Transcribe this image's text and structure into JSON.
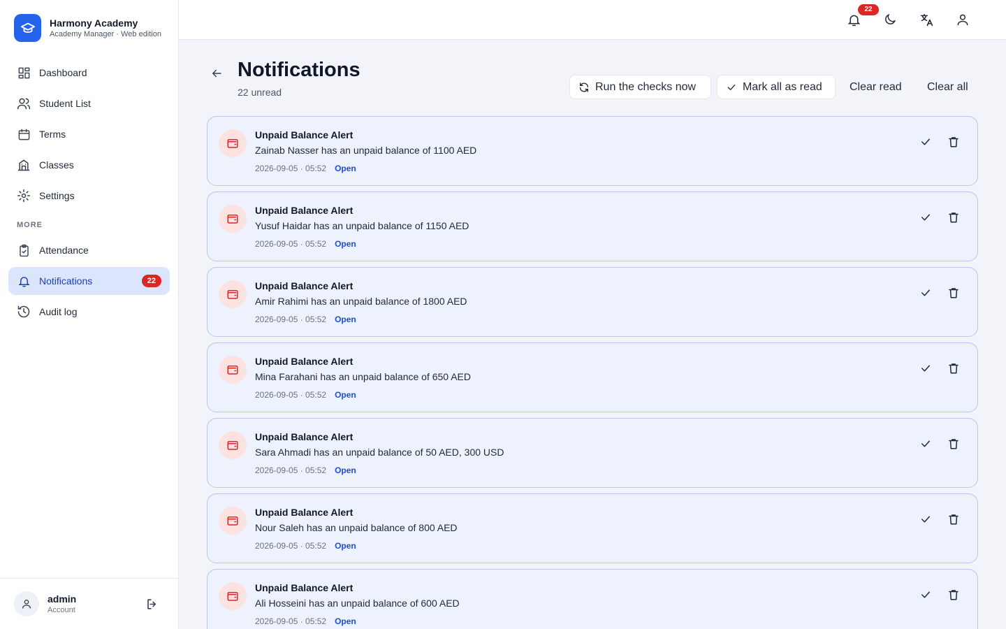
{
  "brand": {
    "name": "Harmony Academy",
    "subtitle": "Academy Manager · Web edition"
  },
  "sidebar": {
    "items": [
      {
        "label": "Dashboard",
        "icon": "dashboard-icon"
      },
      {
        "label": "Student List",
        "icon": "users-icon"
      },
      {
        "label": "Terms",
        "icon": "calendar-icon"
      },
      {
        "label": "Classes",
        "icon": "building-icon"
      },
      {
        "label": "Settings",
        "icon": "gear-icon"
      }
    ],
    "section_label": "MORE",
    "more_items": [
      {
        "label": "Attendance",
        "icon": "clipboard-icon"
      },
      {
        "label": "Notifications",
        "icon": "bell-icon",
        "badge": "22",
        "active": true
      },
      {
        "label": "Audit log",
        "icon": "history-icon"
      }
    ],
    "account": {
      "name": "admin",
      "role": "Account"
    }
  },
  "topbar": {
    "notification_count": "22"
  },
  "header": {
    "title": "Notifications",
    "unread": "22 unread",
    "actions": {
      "run_checks": "Run the checks now",
      "mark_all_read": "Mark all as read",
      "clear_read": "Clear read",
      "clear_all": "Clear all"
    }
  },
  "notifications": [
    {
      "title": "Unpaid Balance Alert",
      "message": "Zainab Nasser has an unpaid balance of 1100 AED",
      "time": "2026-09-05 · 05:52",
      "link": "Open"
    },
    {
      "title": "Unpaid Balance Alert",
      "message": "Yusuf Haidar has an unpaid balance of 1150 AED",
      "time": "2026-09-05 · 05:52",
      "link": "Open"
    },
    {
      "title": "Unpaid Balance Alert",
      "message": "Amir Rahimi has an unpaid balance of 1800 AED",
      "time": "2026-09-05 · 05:52",
      "link": "Open"
    },
    {
      "title": "Unpaid Balance Alert",
      "message": "Mina Farahani has an unpaid balance of 650 AED",
      "time": "2026-09-05 · 05:52",
      "link": "Open"
    },
    {
      "title": "Unpaid Balance Alert",
      "message": "Sara Ahmadi has an unpaid balance of 50 AED, 300 USD",
      "time": "2026-09-05 · 05:52",
      "link": "Open"
    },
    {
      "title": "Unpaid Balance Alert",
      "message": "Nour Saleh has an unpaid balance of 800 AED",
      "time": "2026-09-05 · 05:52",
      "link": "Open"
    },
    {
      "title": "Unpaid Balance Alert",
      "message": "Ali Hosseini has an unpaid balance of 600 AED",
      "time": "2026-09-05 · 05:52",
      "link": "Open"
    }
  ]
}
